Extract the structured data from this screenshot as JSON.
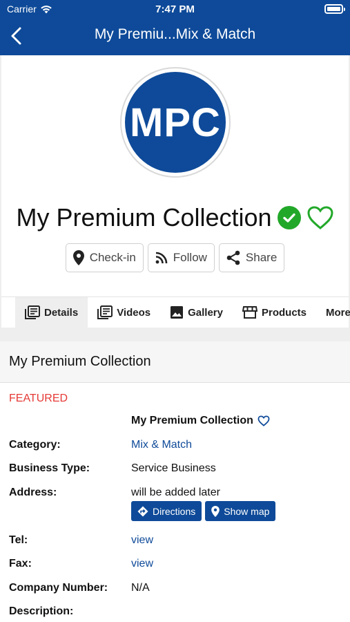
{
  "status": {
    "carrier": "Carrier",
    "time": "7:47 PM"
  },
  "nav": {
    "title": "My Premiu...Mix & Match"
  },
  "header": {
    "logo_text": "MPC",
    "business_name": "My Premium Collection",
    "actions": {
      "checkin": "Check-in",
      "follow": "Follow",
      "share": "Share"
    },
    "tabs": {
      "details": "Details",
      "videos": "Videos",
      "gallery": "Gallery",
      "products": "Products",
      "more": "More"
    }
  },
  "details": {
    "section_title": "My Premium Collection",
    "featured": "FEATURED",
    "name_value": "My Premium Collection",
    "category": {
      "label": "Category:",
      "value": "Mix & Match"
    },
    "business_type": {
      "label": "Business Type:",
      "value": "Service Business"
    },
    "address": {
      "label": "Address:",
      "value": "will be added later",
      "directions": "Directions",
      "show_map": "Show map"
    },
    "tel": {
      "label": "Tel:",
      "value": "view"
    },
    "fax": {
      "label": "Fax:",
      "value": "view"
    },
    "company_number": {
      "label": "Company Number:",
      "value": "N/A"
    },
    "description": {
      "label": "Description:"
    }
  },
  "colors": {
    "brand": "#0e4a99",
    "verified": "#22a829",
    "featured": "#e53935"
  }
}
